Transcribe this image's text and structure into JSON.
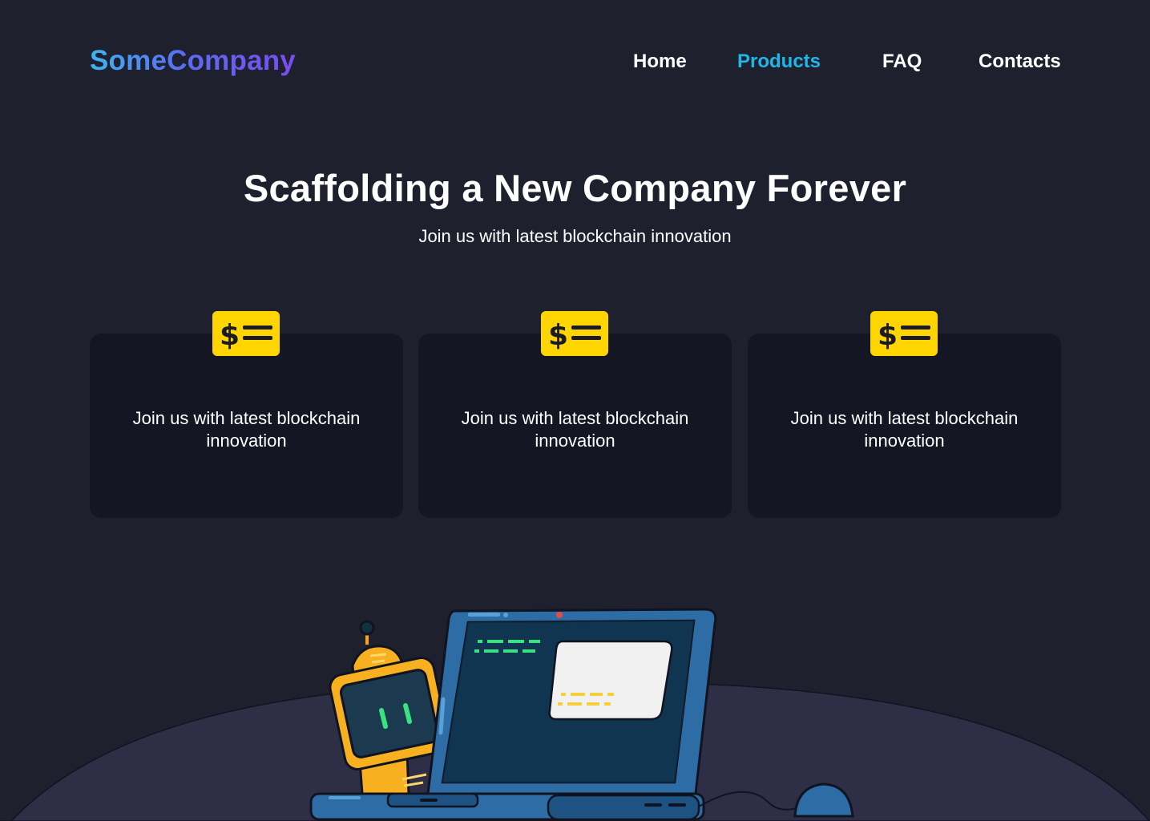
{
  "brand": {
    "name": "SomeCompany"
  },
  "nav": {
    "items": [
      {
        "label": "Home",
        "active": false
      },
      {
        "label": "Products",
        "active": true
      },
      {
        "label": "FAQ",
        "active": false
      },
      {
        "label": "Contacts",
        "active": false
      }
    ]
  },
  "hero": {
    "title": "Scaffolding a New Company Forever",
    "subtitle": "Join us with latest blockchain innovation"
  },
  "cards": [
    {
      "icon": "dollar-list-icon",
      "text": "Join us with latest blockchain innovation"
    },
    {
      "icon": "dollar-list-icon",
      "text": "Join us with latest blockchain innovation"
    },
    {
      "icon": "dollar-list-icon",
      "text": "Join us with latest blockchain innovation"
    }
  ],
  "colors": {
    "background": "#1f202e",
    "card": "#141623",
    "accent": "#1fb6e8",
    "icon_yellow": "#fed401",
    "logo_gradient": [
      "#3fb4f0",
      "#7a4cf0"
    ]
  }
}
